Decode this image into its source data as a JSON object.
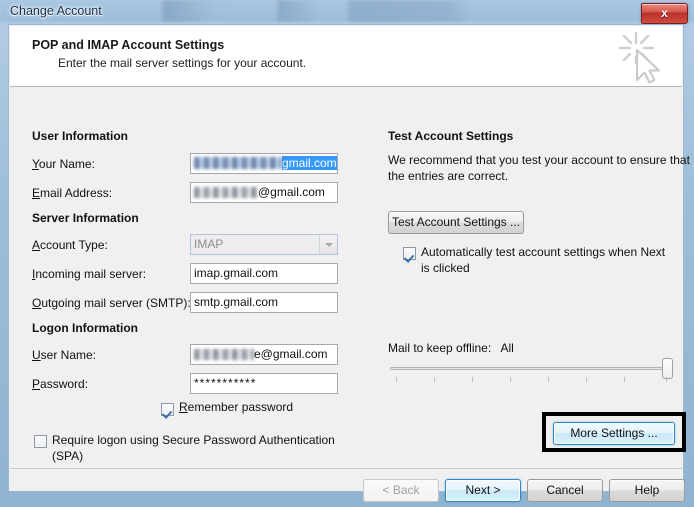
{
  "window": {
    "title": "Change Account",
    "close_label": "x",
    "close_icon": "close-icon"
  },
  "header": {
    "title": "POP and IMAP Account Settings",
    "subtitle": "Enter the mail server settings for your account.",
    "watermark_icon": "cursor-sparkle-icon"
  },
  "left": {
    "user_information_title": "User Information",
    "your_name_label": "Your Name:",
    "your_name_value": "gmail.com",
    "your_name_redacted": true,
    "email_address_label": "Email Address:",
    "email_address_value": "@gmail.com",
    "email_address_redacted": true,
    "server_information_title": "Server Information",
    "account_type_label": "Account Type:",
    "account_type_value": "IMAP",
    "account_type_disabled": true,
    "incoming_label": "Incoming mail server:",
    "incoming_value": "imap.gmail.com",
    "outgoing_label": "Outgoing mail server (SMTP):",
    "outgoing_value": "smtp.gmail.com",
    "logon_information_title": "Logon Information",
    "user_name_label": "User Name:",
    "user_name_value": "e@gmail.com",
    "user_name_redacted": true,
    "password_label": "Password:",
    "password_value": "***********",
    "remember_password_label": "Remember password",
    "remember_password_checked": true,
    "spa_label_line1": "Require logon using Secure Password Authentication",
    "spa_label_line2": "(SPA)",
    "spa_checked": false
  },
  "right": {
    "test_title": "Test Account Settings",
    "test_desc_line1": "We recommend that you test your account to ensure that",
    "test_desc_line2": "the entries are correct.",
    "test_button_label": "Test Account Settings ...",
    "auto_test_line1": "Automatically test account settings when Next",
    "auto_test_line2": "is clicked",
    "auto_test_checked": true,
    "offline_label": "Mail to keep offline:",
    "offline_value": "All",
    "slider_position_percent": 100,
    "slider_tick_count": 8,
    "more_settings_label": "More Settings ...",
    "more_settings_highlighted": true
  },
  "footer": {
    "back_label": "< Back",
    "back_disabled": true,
    "next_label": "Next >",
    "next_default": true,
    "cancel_label": "Cancel",
    "help_label": "Help"
  },
  "colors": {
    "accent_blue": "#3399ff",
    "default_button_border": "#2c8ac4",
    "dialog_bg": "#f0f0f0",
    "header_bg": "#ffffff",
    "close_red": "#cf4b41",
    "highlight_black": "#000000"
  }
}
